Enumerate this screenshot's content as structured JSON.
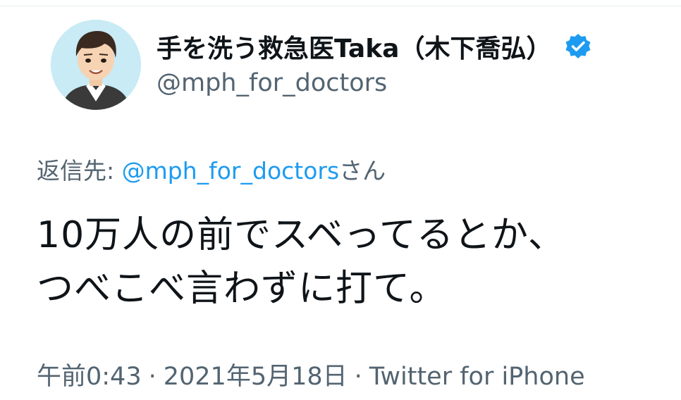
{
  "profile": {
    "display_name": "手を洗う救急医Taka（木下喬弘）",
    "handle": "@mph_for_doctors",
    "verified": true
  },
  "reply": {
    "prefix": "返信先: ",
    "mention": "@mph_for_doctors",
    "suffix": "さん"
  },
  "tweet": {
    "lines": [
      "10万人の前でスベってるとか、",
      "つべこべ言わずに打て。"
    ]
  },
  "meta": {
    "time": "午前0:43",
    "separator": "·",
    "date": "2021年5月18日",
    "source": "Twitter for iPhone"
  },
  "colors": {
    "accent": "#1d9bf0",
    "secondary_text": "#536471",
    "primary_text": "#0f1419"
  },
  "icons": {
    "verified": "verified-badge-icon",
    "avatar": "avatar-illustration"
  }
}
